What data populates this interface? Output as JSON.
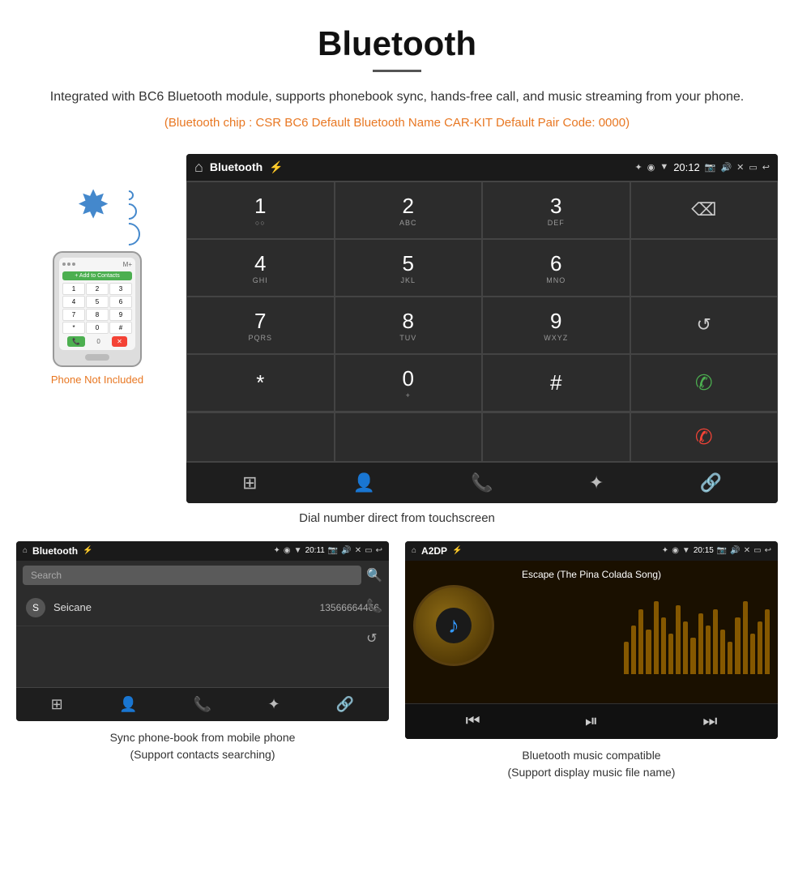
{
  "header": {
    "title": "Bluetooth",
    "description": "Integrated with BC6 Bluetooth module, supports phonebook sync, hands-free call, and music streaming from your phone.",
    "specs": "(Bluetooth chip : CSR BC6    Default Bluetooth Name CAR-KIT    Default Pair Code: 0000)"
  },
  "phone_label": "Phone Not Included",
  "phone_keypad": {
    "add_contacts": "+ Add to Contacts",
    "keys": [
      "1",
      "2",
      "3",
      "4",
      "5",
      "6",
      "7",
      "8",
      "9",
      "*",
      "0",
      "#"
    ]
  },
  "dial_screen": {
    "app_name": "Bluetooth",
    "time": "20:12",
    "keys": [
      {
        "num": "1",
        "sub": "○○"
      },
      {
        "num": "2",
        "sub": "ABC"
      },
      {
        "num": "3",
        "sub": "DEF"
      },
      {
        "num": "",
        "sub": ""
      },
      {
        "num": "4",
        "sub": "GHI"
      },
      {
        "num": "5",
        "sub": "JKL"
      },
      {
        "num": "6",
        "sub": "MNO"
      },
      {
        "num": "",
        "sub": ""
      },
      {
        "num": "7",
        "sub": "PQRS"
      },
      {
        "num": "8",
        "sub": "TUV"
      },
      {
        "num": "9",
        "sub": "WXYZ"
      },
      {
        "num": "",
        "sub": ""
      },
      {
        "num": "*",
        "sub": ""
      },
      {
        "num": "0",
        "sub": "+"
      },
      {
        "num": "#",
        "sub": ""
      },
      {
        "num": "",
        "sub": ""
      }
    ]
  },
  "dial_caption": "Dial number direct from touchscreen",
  "phonebook_screen": {
    "app_name": "Bluetooth",
    "time": "20:11",
    "search_placeholder": "Search",
    "contact_initial": "S",
    "contact_name": "Seicane",
    "contact_number": "13566664466"
  },
  "phonebook_caption": "Sync phone-book from mobile phone\n(Support contacts searching)",
  "music_screen": {
    "app_name": "A2DP",
    "time": "20:15",
    "song_title": "Escape (The Pina Colada Song)",
    "eq_bars": [
      40,
      60,
      80,
      55,
      90,
      70,
      50,
      85,
      65,
      45,
      75,
      60,
      80,
      55,
      40,
      70,
      90,
      50,
      65,
      80
    ]
  },
  "music_caption": "Bluetooth music compatible\n(Support display music file name)",
  "icons": {
    "home": "⌂",
    "bluetooth": "⌘",
    "backspace": "⌫",
    "refresh": "↺",
    "call_green": "📞",
    "call_end": "📵",
    "grid": "⊞",
    "person": "👤",
    "phone": "📱",
    "bt": "⚡",
    "link": "🔗",
    "search": "🔍",
    "prev": "⏮",
    "play": "⏯",
    "next": "⏭"
  }
}
